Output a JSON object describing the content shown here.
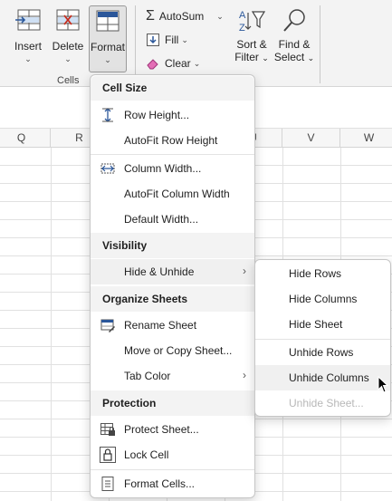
{
  "ribbon": {
    "insert_label": "Insert",
    "delete_label": "Delete",
    "format_label": "Format",
    "cells_group_label": "Cells",
    "autosum_label": "AutoSum",
    "fill_label": "Fill",
    "clear_label": "Clear",
    "sort_filter_line1": "Sort &",
    "sort_filter_line2": "Filter",
    "find_select_line1": "Find &",
    "find_select_line2": "Select"
  },
  "columns": [
    "Q",
    "R",
    "U",
    "V",
    "W"
  ],
  "format_menu": {
    "sections": {
      "cell_size": "Cell Size",
      "visibility": "Visibility",
      "organize": "Organize Sheets",
      "protection": "Protection"
    },
    "items": {
      "row_height": "Row Height...",
      "autofit_row": "AutoFit Row Height",
      "column_width": "Column Width...",
      "autofit_column": "AutoFit Column Width",
      "default_width": "Default Width...",
      "hide_unhide": "Hide & Unhide",
      "rename_sheet": "Rename Sheet",
      "move_copy": "Move or Copy Sheet...",
      "tab_color": "Tab Color",
      "protect_sheet": "Protect Sheet...",
      "lock_cell": "Lock Cell",
      "format_cells": "Format Cells..."
    }
  },
  "submenu": {
    "hide_rows": "Hide Rows",
    "hide_columns": "Hide Columns",
    "hide_sheet": "Hide Sheet",
    "unhide_rows": "Unhide Rows",
    "unhide_columns": "Unhide Columns",
    "unhide_sheet": "Unhide Sheet..."
  },
  "colors": {
    "accent": "#2b579a",
    "highlight": "#f0f0f0",
    "disabled": "#b8b8b8"
  },
  "icons": {
    "insert": "insert-cells-icon",
    "delete": "delete-cells-icon",
    "format": "format-cells-icon",
    "autosum": "sigma-icon",
    "fill": "fill-down-icon",
    "clear": "eraser-icon",
    "sort_filter": "sort-filter-icon",
    "find_select": "magnifier-icon"
  }
}
